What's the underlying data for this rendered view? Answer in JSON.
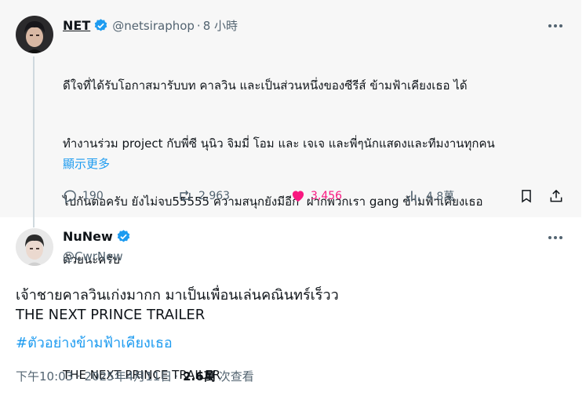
{
  "parent_tweet": {
    "display_name": "NET",
    "handle": "@netsiraphop",
    "separator": "·",
    "time_ago": "8 小時",
    "text_lines": [
      "ดีใจที่ได้รับโอกาสมารับบท คาลวิน และเป็นส่วนหนึ่งของซีรีส์ ข้ามฟ้าเคียงเธอ ได้",
      "ทำงานร่วม project กับพี่ซี นุนิว จิมมี่ โอม และ เจเจ และพี่ๆนักแสดงและทีมงานทุกคน",
      "ไปกันต่อครับ ยังไม่จบ55555 ความสนุกยังมีอีก  ฝากพวกเรา gang ข้ามฟ้าเคียงเธอ",
      "ด้วยนะครับ",
      "",
      "THE NEXT PRINCE TRAILER"
    ],
    "show_more": "顯示更多",
    "actions": {
      "replies": "190",
      "reposts": "2,963",
      "likes": "3,456",
      "views": "4.8萬"
    }
  },
  "reply_tweet": {
    "display_name": "NuNew",
    "handle": "@CwrNew",
    "text_line1": "เจ้าชายคาลวินเก่งมากก มาเป็นเพื่อนเล่นคณินทร์เร็วว",
    "text_line2": "THE NEXT PRINCE TRAILER",
    "hashtag": "#ตัวอย่างข้ามฟ้าเคียงเธอ",
    "timestamp": "下午10:03 · 2025年4月11日",
    "separator": "·",
    "views_count": "2.6萬",
    "views_label": "次查看"
  },
  "colors": {
    "accent": "#1d9bf0",
    "like": "#f91880",
    "muted": "#536471",
    "text": "#0f1419",
    "parent_bg": "#f7f7f7"
  },
  "icons": [
    "more-icon",
    "verified-badge-icon",
    "reply-icon",
    "repost-icon",
    "like-icon",
    "views-icon",
    "bookmark-icon",
    "share-icon"
  ]
}
